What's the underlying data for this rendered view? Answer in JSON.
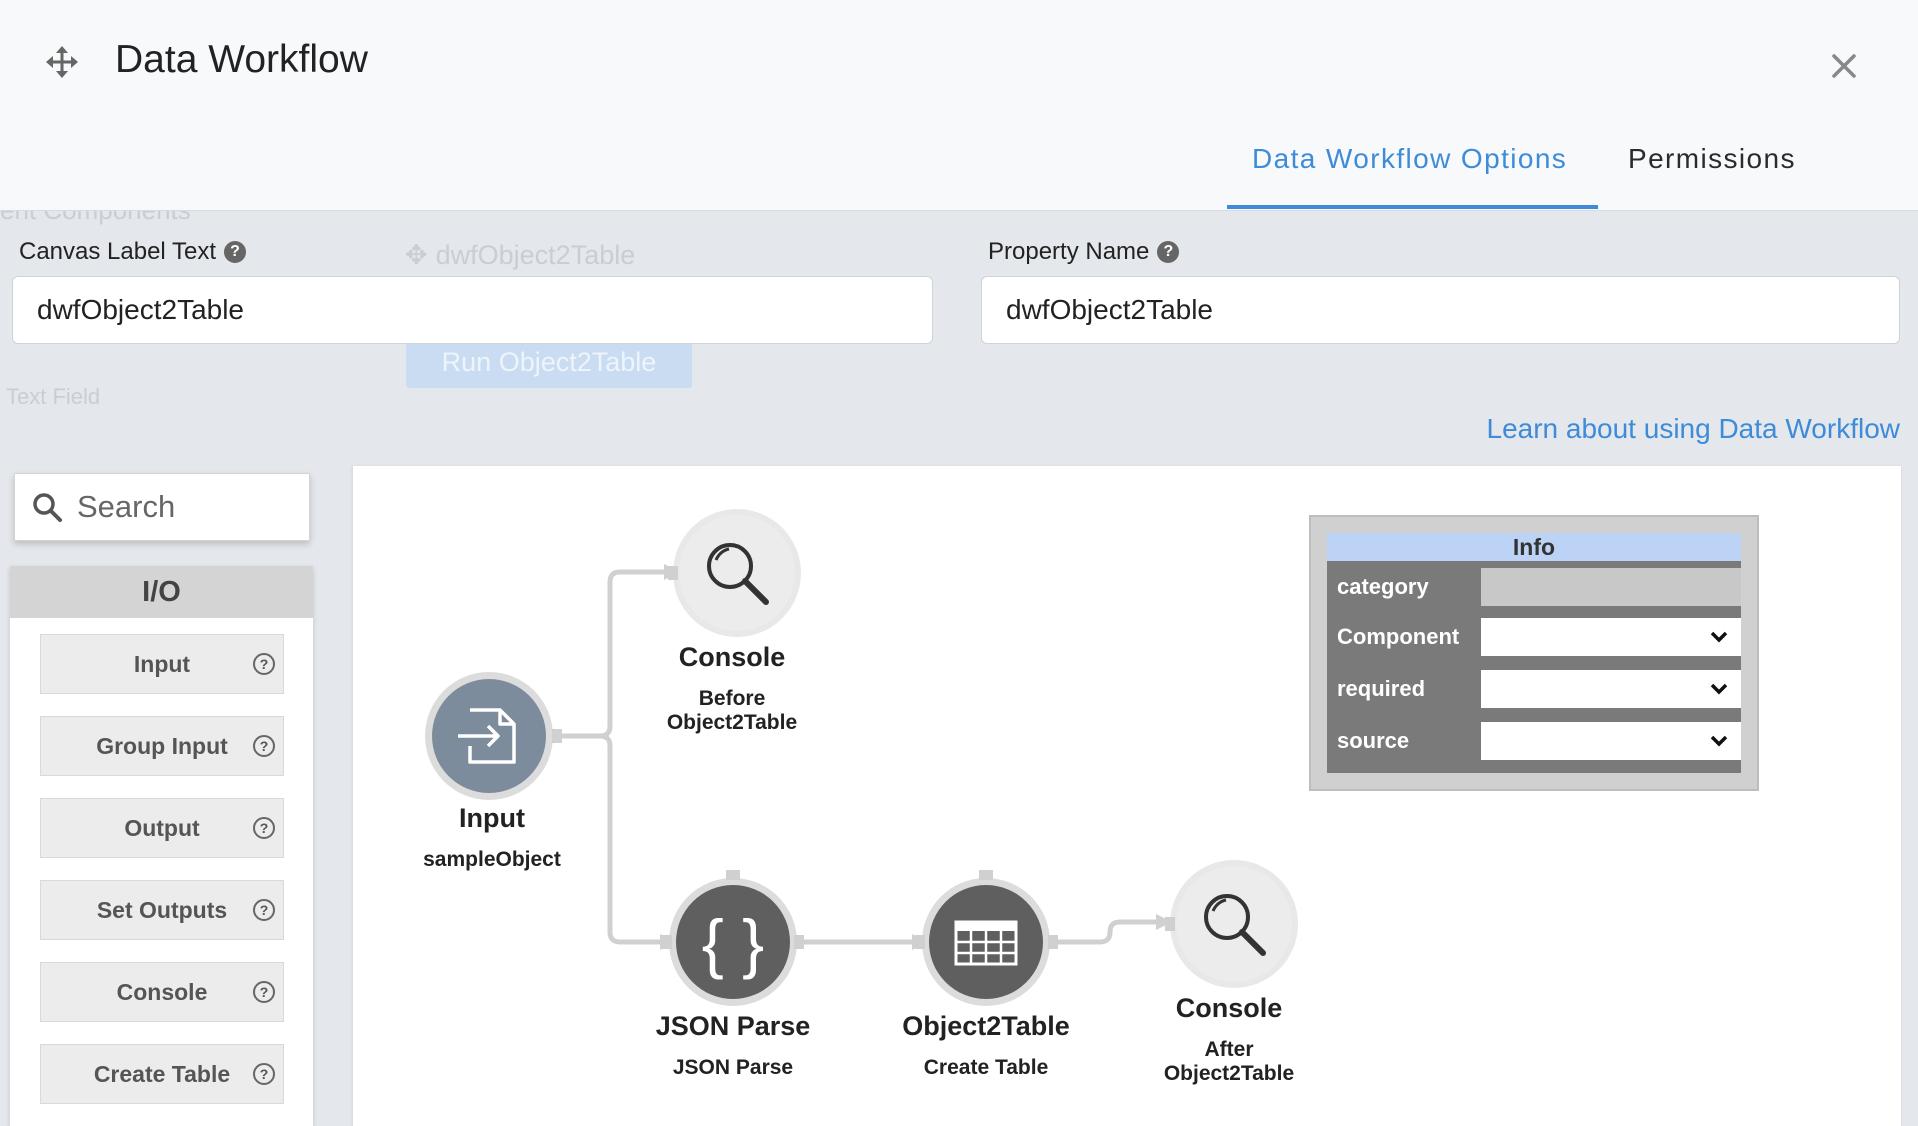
{
  "dialog": {
    "title": "Data Workflow",
    "tabs": [
      {
        "label": "Data Workflow Options",
        "active": true
      },
      {
        "label": "Permissions",
        "active": false
      }
    ]
  },
  "form": {
    "canvas_label": {
      "label": "Canvas Label Text",
      "value": "dwfObject2Table"
    },
    "property_name": {
      "label": "Property Name",
      "value": "dwfObject2Table"
    }
  },
  "learn_link": "Learn about using Data Workflow",
  "background": {
    "heading": "ent Components",
    "control_name": "dwfObject2Table",
    "button_label": "Run Object2Table",
    "text_field": "Text Field"
  },
  "palette": {
    "search_placeholder": "Search",
    "section": "I/O",
    "items": [
      "Input",
      "Group Input",
      "Output",
      "Set Outputs",
      "Console",
      "Create Table"
    ]
  },
  "nodes": {
    "input": {
      "title": "Input",
      "sub": "sampleObject"
    },
    "console_before": {
      "title": "Console",
      "sub1": "Before",
      "sub2": "Object2Table"
    },
    "json_parse": {
      "title": "JSON Parse",
      "sub": "JSON Parse"
    },
    "object2table": {
      "title": "Object2Table",
      "sub": "Create Table"
    },
    "console_after": {
      "title": "Console",
      "sub1": "After",
      "sub2": "Object2Table"
    }
  },
  "info_panel": {
    "title": "Info",
    "rows": [
      "category",
      "Component",
      "required",
      "source"
    ]
  },
  "colors": {
    "accent": "#3d8bd9",
    "node_dark": "#666666",
    "node_input": "#7d8c9c",
    "node_light": "#ececec"
  }
}
